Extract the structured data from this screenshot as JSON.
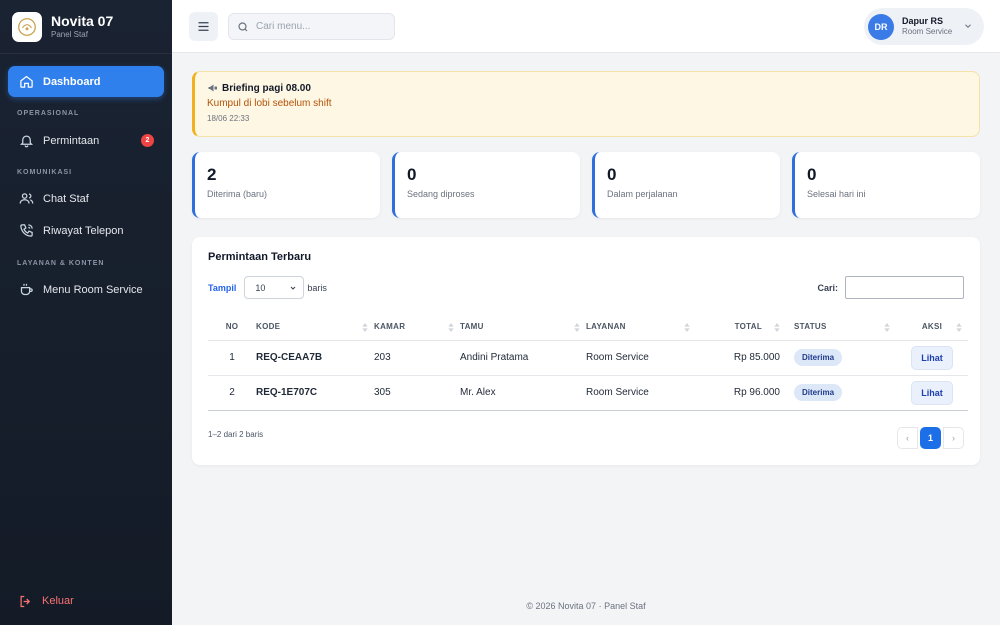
{
  "brand": {
    "title": "Novita 07",
    "subtitle": "Panel Staf"
  },
  "sidebar": {
    "items": [
      {
        "label": "Dashboard",
        "icon": "home-icon",
        "active": true
      },
      {
        "label": "Permintaan",
        "icon": "bell-icon",
        "badge": "2"
      },
      {
        "label": "Chat Staf",
        "icon": "users-icon"
      },
      {
        "label": "Riwayat Telepon",
        "icon": "phone-icon"
      },
      {
        "label": "Menu Room Service",
        "icon": "coffee-cup-icon"
      }
    ],
    "sections": [
      "OPERASIONAL",
      "KOMUNIKASI",
      "LAYANAN & KONTEN"
    ],
    "logout_label": "Keluar"
  },
  "topbar": {
    "search_placeholder": "Cari menu...",
    "user": {
      "initials": "DR",
      "name": "Dapur RS",
      "role": "Room Service"
    }
  },
  "announcement": {
    "title": "Briefing pagi 08.00",
    "message": "Kumpul di lobi sebelum shift",
    "time": "18/06 22:33"
  },
  "stats": [
    {
      "value": "2",
      "label": "Diterima (baru)"
    },
    {
      "value": "0",
      "label": "Sedang diproses"
    },
    {
      "value": "0",
      "label": "Dalam perjalanan"
    },
    {
      "value": "0",
      "label": "Selesai hari ini"
    }
  ],
  "requests": {
    "title": "Permintaan Terbaru",
    "show_label": "Tampil",
    "page_size": "10",
    "rows_label": "baris",
    "search_label": "Cari:",
    "columns": [
      "NO",
      "KODE",
      "KAMAR",
      "TAMU",
      "LAYANAN",
      "TOTAL",
      "STATUS",
      "AKSI"
    ],
    "rows": [
      {
        "no": "1",
        "kode": "REQ-CEAA7B",
        "kamar": "203",
        "tamu": "Andini Pratama",
        "layanan": "Room Service",
        "total": "Rp 85.000",
        "status": "Diterima",
        "aksi": "Lihat"
      },
      {
        "no": "2",
        "kode": "REQ-1E707C",
        "kamar": "305",
        "tamu": "Mr. Alex",
        "layanan": "Room Service",
        "total": "Rp 96.000",
        "status": "Diterima",
        "aksi": "Lihat"
      }
    ],
    "page_info": "1–2 dari 2 baris",
    "pagination": {
      "prev": "‹",
      "current": "1",
      "next": "›"
    }
  },
  "footer": "© 2026 Novita 07 · Panel Staf",
  "colors": {
    "accent": "#2f80ed",
    "sidebar_bg": "#1a2332",
    "badge": "#ef4444",
    "warning": "#f2b01e",
    "logout": "#f87171"
  }
}
